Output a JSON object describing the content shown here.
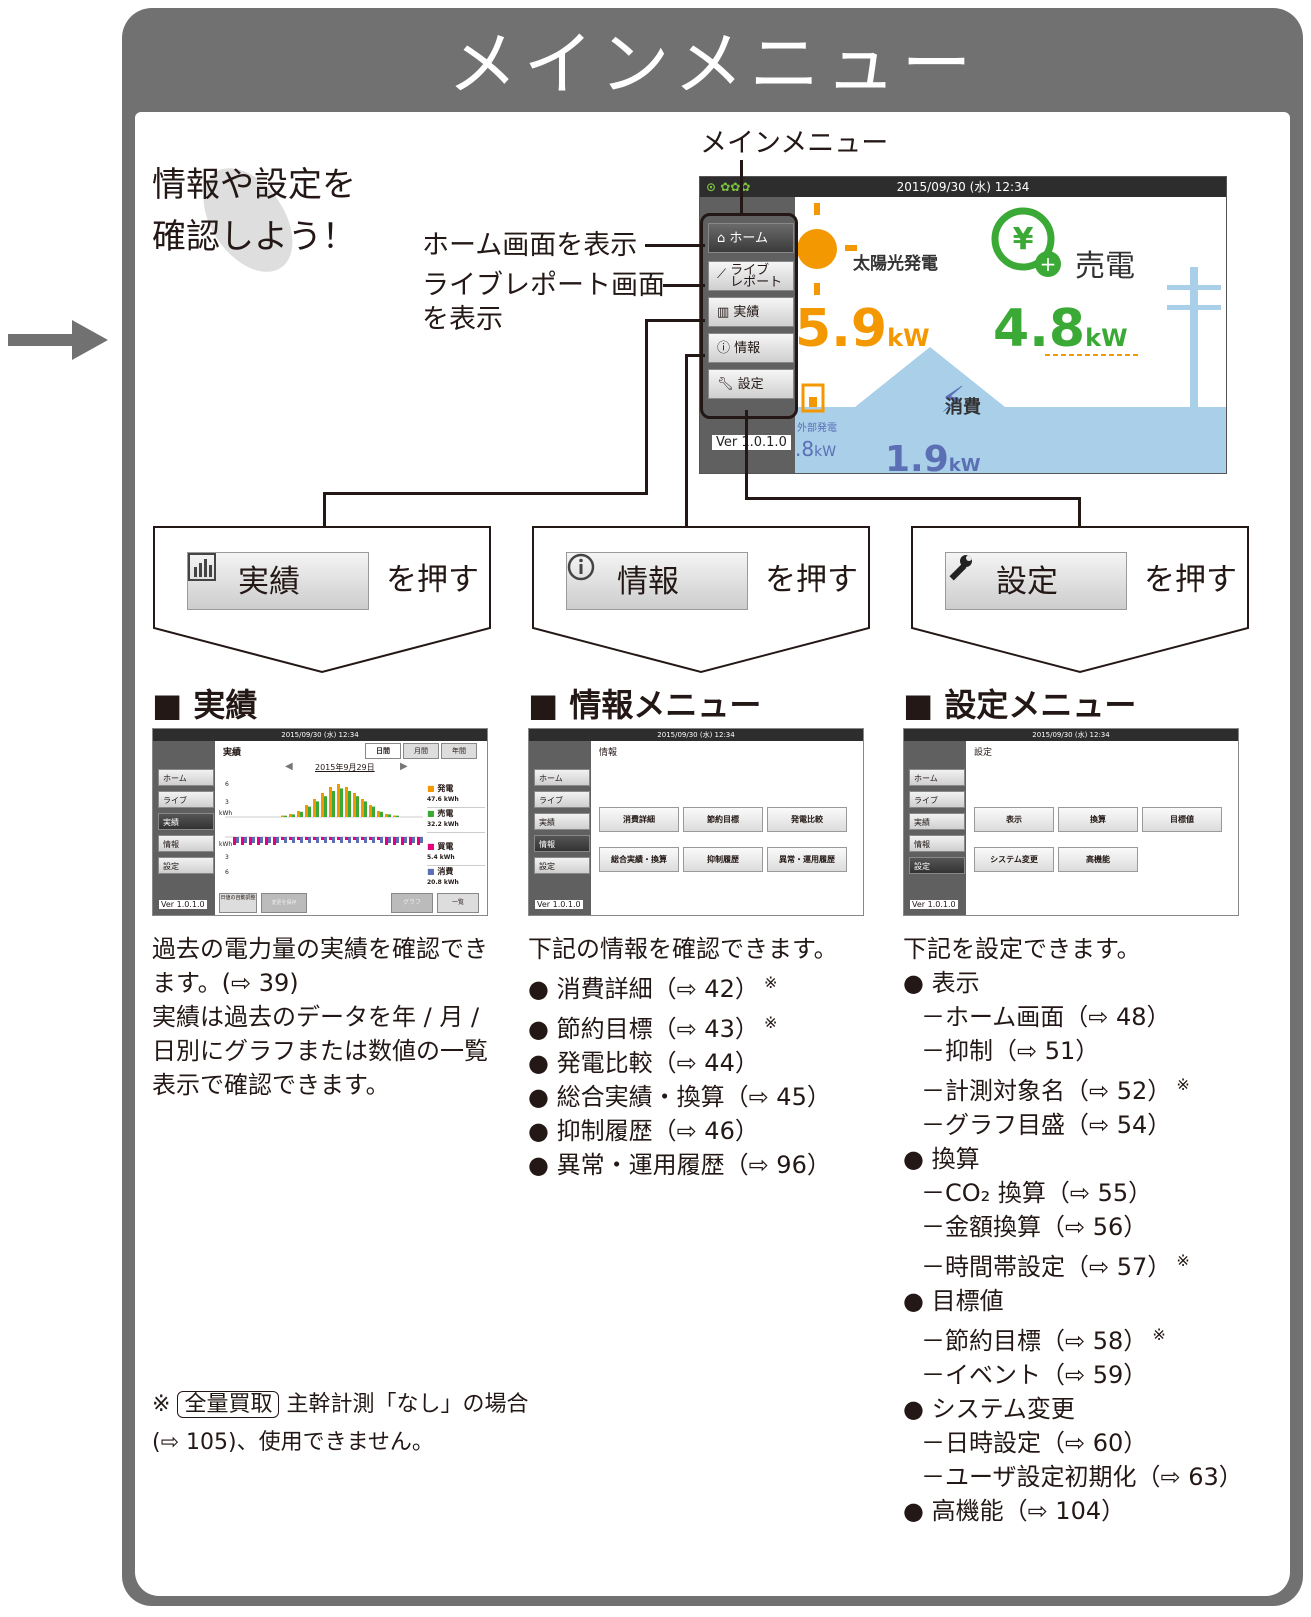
{
  "page_title": "メインメニュー",
  "intro": {
    "line1": "情報や設定を",
    "line2": "確認しよう！"
  },
  "labels": {
    "mainmenu": "メインメニュー",
    "home_display": "ホーム画面を表示",
    "live_line1": "ライブレポート画面",
    "live_line2": "を表示"
  },
  "device": {
    "datetime": "2015/09/30 (水) 12:34",
    "menu": {
      "home": "ホーム",
      "live1": "ライブ",
      "live2": "レポート",
      "results": "実績",
      "info": "情報",
      "settings": "設定"
    },
    "version": "Ver 1.0.1.0",
    "solar_label": "太陽光発電",
    "solar_value": "5.9",
    "unit": "kW",
    "sell_label": "売電",
    "sell_value": "4.8",
    "consume_label": "消費",
    "consume_value": "1.9",
    "external_label": "外部発電",
    "external_value": ".8"
  },
  "callouts": {
    "results_button": "実績",
    "info_button": "情報",
    "settings_button": "設定",
    "push": "を押す"
  },
  "sections": {
    "results": {
      "heading": "■ 実績",
      "description": [
        "過去の電力量の実績を確認でき",
        "ます。(⇨ 39)",
        "実績は過去のデータを年 / 月 /",
        "日別にグラフまたは数値の一覧",
        "表示で確認できます。"
      ]
    },
    "info": {
      "heading": "■ 情報メニュー",
      "intro": "下記の情報を確認できます。",
      "items": [
        {
          "text": "● 消費詳細（⇨ 42）",
          "mark": "※"
        },
        {
          "text": "● 節約目標（⇨ 43）",
          "mark": "※"
        },
        {
          "text": "● 発電比較（⇨ 44）",
          "mark": ""
        },
        {
          "text": "● 総合実績・換算（⇨ 45）",
          "mark": ""
        },
        {
          "text": "● 抑制履歴（⇨ 46）",
          "mark": ""
        },
        {
          "text": "● 異常・運用履歴（⇨ 96）",
          "mark": ""
        }
      ]
    },
    "settings": {
      "heading": "■ 設定メニュー",
      "intro": "下記を設定できます。",
      "items": [
        {
          "text": "● 表示",
          "mark": "",
          "sub": false
        },
        {
          "text": "－ホーム画面（⇨ 48）",
          "mark": "",
          "sub": true
        },
        {
          "text": "－抑制（⇨ 51）",
          "mark": "",
          "sub": true
        },
        {
          "text": "－計測対象名（⇨ 52）",
          "mark": "※",
          "sub": true
        },
        {
          "text": "－グラフ目盛（⇨ 54）",
          "mark": "",
          "sub": true
        },
        {
          "text": "● 換算",
          "mark": "",
          "sub": false
        },
        {
          "text": "－CO₂ 換算（⇨ 55）",
          "mark": "",
          "sub": true
        },
        {
          "text": "－金額換算（⇨ 56）",
          "mark": "",
          "sub": true
        },
        {
          "text": "－時間帯設定（⇨ 57）",
          "mark": "※",
          "sub": true
        },
        {
          "text": "● 目標値",
          "mark": "",
          "sub": false
        },
        {
          "text": "－節約目標（⇨ 58）",
          "mark": "※",
          "sub": true
        },
        {
          "text": "－イベント（⇨ 59）",
          "mark": "",
          "sub": true
        },
        {
          "text": "● システム変更",
          "mark": "",
          "sub": false
        },
        {
          "text": "－日時設定（⇨ 60）",
          "mark": "",
          "sub": true
        },
        {
          "text": "－ユーザ設定初期化（⇨ 63）",
          "mark": "",
          "sub": true
        },
        {
          "text": "● 高機能（⇨ 104）",
          "mark": "",
          "sub": false
        }
      ]
    }
  },
  "mini_results": {
    "title": "実績",
    "tabs": [
      "日間",
      "月間",
      "年間"
    ],
    "date": "2015年9月29日",
    "legend": [
      {
        "name": "発電",
        "value": "47.6 kWh",
        "color": "#f39800"
      },
      {
        "name": "売電",
        "value": "32.2 kWh",
        "color": "#3aa935"
      },
      {
        "name": "買電",
        "value": "5.4 kWh",
        "color": "#e4007f"
      },
      {
        "name": "消費",
        "value": "20.8 kWh",
        "color": "#5b6fb5"
      }
    ],
    "btn_self": "日値の自動調整",
    "btn_change": "変更を保存",
    "btn_graph": "グラフ",
    "btn_list": "一覧",
    "axis": [
      "6",
      "3",
      "kWh",
      "kWh",
      "3",
      "6"
    ]
  },
  "mini_info": {
    "title": "情報",
    "buttons": [
      "消費詳細",
      "節約目標",
      "発電比較",
      "総合実績・換算",
      "抑制履歴",
      "異常・運用履歴"
    ]
  },
  "mini_settings": {
    "title": "設定",
    "buttons": [
      "表示",
      "換算",
      "目標値",
      "システム変更",
      "高機能"
    ]
  },
  "footnote": {
    "mark": "※",
    "boxed": "全量買取",
    "line1": "主幹計測「なし」の場合",
    "line2": "(⇨ 105)、使用できません。"
  },
  "colors": {
    "frame": "#717171",
    "solar": "#f39800",
    "sell": "#3aa935",
    "consume": "#5b6fb5",
    "sky": "#a9cfe9"
  }
}
